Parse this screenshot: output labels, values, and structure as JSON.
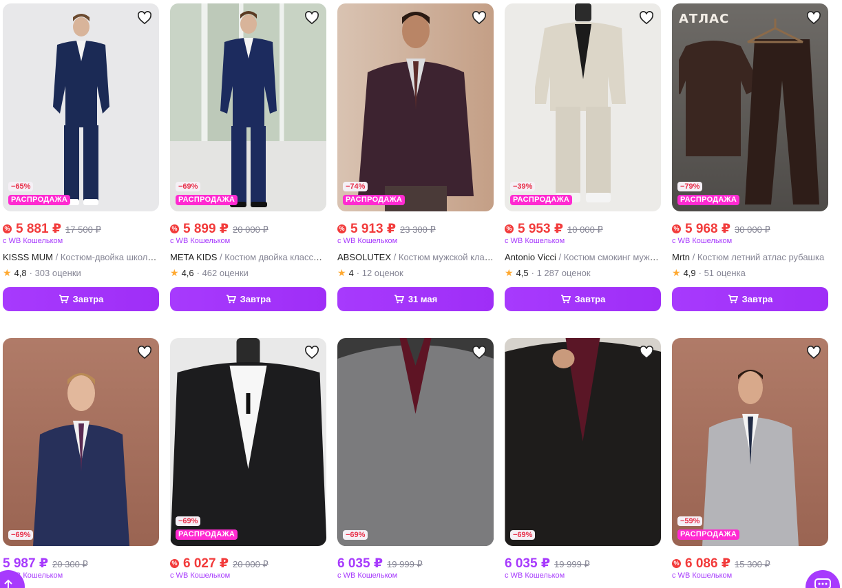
{
  "currency": "₽",
  "buy_icon": "cart-icon",
  "wallet_note": "с WB Кошельком",
  "sale_label": "РАСПРОДАЖА",
  "colors": {
    "accent": "#a73afd",
    "price_red": "#f23b3b",
    "sale_pink": "#ff2ad1",
    "star": "#ffa930"
  },
  "row1": [
    {
      "discount": "−65%",
      "sale": true,
      "wallet_icon": true,
      "price": "5 881 ₽",
      "old_price": "17 500 ₽",
      "brand": "KISSS MUM",
      "title": " / Костюм-двойка школьный",
      "rating": "4,8",
      "reviews": "· 303 оценки",
      "button": "Завтра",
      "bg": "#e9e9ea"
    },
    {
      "discount": "−69%",
      "sale": true,
      "wallet_icon": true,
      "price": "5 899 ₽",
      "old_price": "20 000 ₽",
      "brand": "META KIDS",
      "title": " / Костюм двойка классический",
      "rating": "4,6",
      "reviews": "· 462 оценки",
      "button": "Завтра",
      "bg": "#dfe3df"
    },
    {
      "discount": "−74%",
      "sale": true,
      "wallet_icon": true,
      "price": "5 913 ₽",
      "old_price": "23 300 ₽",
      "brand": "ABSOLUTEX",
      "title": " / Костюм мужской классический",
      "rating": "4",
      "reviews": "· 12 оценок",
      "button": "31 мая",
      "bg": "#c9ad98"
    },
    {
      "discount": "−39%",
      "sale": true,
      "wallet_icon": true,
      "price": "5 953 ₽",
      "old_price": "10 000 ₽",
      "brand": "Antonio Vicci",
      "title": " / Костюм смокинг мужской",
      "rating": "4,5",
      "reviews": "· 1 287 оценок",
      "button": "Завтра",
      "bg": "#ecebe8"
    },
    {
      "discount": "−79%",
      "sale": true,
      "wallet_icon": true,
      "price": "5 968 ₽",
      "old_price": "30 000 ₽",
      "brand": "Mrtn",
      "title": " / Костюм летний атлас рубашка",
      "rating": "4,9",
      "reviews": "· 51 оценка",
      "button": "Завтра",
      "bg": "#5c5a57",
      "logo_text": "АТЛАС"
    }
  ],
  "row2": [
    {
      "discount": "−69%",
      "sale": false,
      "wallet_icon": false,
      "price": "5 987 ₽",
      "old_price": "20 300 ₽",
      "bg": "#a5705e"
    },
    {
      "discount": "−69%",
      "sale": true,
      "wallet_icon": true,
      "price": "6 027 ₽",
      "old_price": "20 000 ₽",
      "bg": "#e9e9e9"
    },
    {
      "discount": "−69%",
      "sale": false,
      "wallet_icon": false,
      "price": "6 035 ₽",
      "old_price": "19 999 ₽",
      "bg": "#3a3a3a"
    },
    {
      "discount": "−69%",
      "sale": false,
      "wallet_icon": false,
      "price": "6 035 ₽",
      "old_price": "19 999 ₽",
      "bg": "#2e2a28"
    },
    {
      "discount": "−59%",
      "sale": true,
      "wallet_icon": true,
      "price": "6 086 ₽",
      "old_price": "15 300 ₽",
      "bg": "#a5705e"
    }
  ]
}
